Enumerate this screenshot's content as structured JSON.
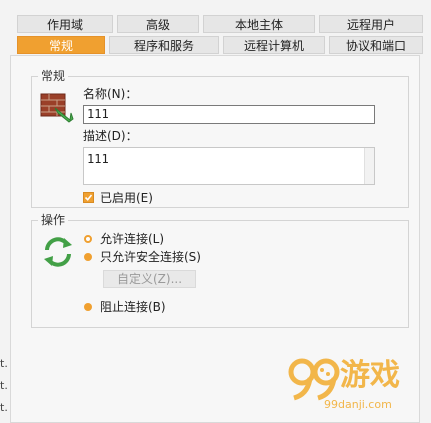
{
  "tabs_row1": [
    "作用域",
    "高级",
    "本地主体",
    "远程用户"
  ],
  "tabs_row2": [
    "常规",
    "程序和服务",
    "远程计算机",
    "协议和端口"
  ],
  "active_tab": "常规",
  "general": {
    "group_title": "常规",
    "name_label": "名称(N)：",
    "name_value": "111",
    "desc_label": "描述(D)：",
    "desc_value": "111",
    "enabled_label": "已启用(E)",
    "enabled_checked": true
  },
  "action": {
    "group_title": "操作",
    "options": [
      {
        "label": "允许连接(L)",
        "selected": false
      },
      {
        "label": "只允许安全连接(S)",
        "selected": true
      },
      {
        "label": "阻止连接(B)",
        "selected": true
      }
    ],
    "customize_label": "自定义(Z)..."
  },
  "side_fragments": [
    "t.",
    "t.",
    "t."
  ],
  "watermark": {
    "brand": "游戏",
    "url": "99danji.com"
  },
  "colors": {
    "accent": "#f0a030"
  }
}
